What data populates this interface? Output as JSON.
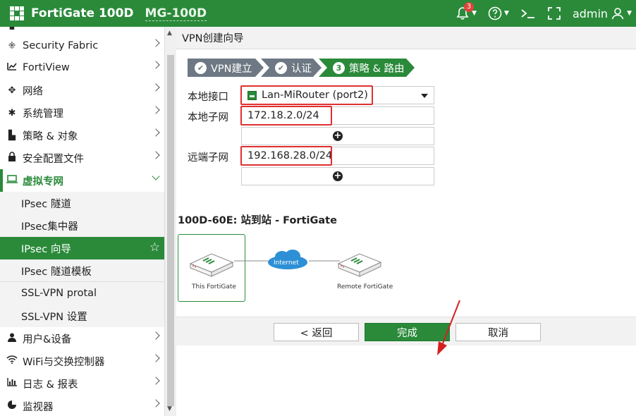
{
  "topbar": {
    "brand": "FortiGate 100D",
    "device": "MG-100D",
    "alert_count": "3",
    "help_icon": "question-circle-icon",
    "cli_icon": "terminal-icon",
    "fullscreen_icon": "fullscreen-icon",
    "user": "admin",
    "accent_color": "#2a8a3a"
  },
  "sidebar": {
    "items": [
      {
        "label": "Security Fabric",
        "icon": "fabric-icon"
      },
      {
        "label": "FortiView",
        "icon": "chart-icon"
      },
      {
        "label": "网络",
        "icon": "network-icon"
      },
      {
        "label": "系统管理",
        "icon": "gear-icon"
      },
      {
        "label": "策略 & 对象",
        "icon": "policy-icon"
      },
      {
        "label": "安全配置文件",
        "icon": "lock-icon"
      },
      {
        "label": "虚拟专网",
        "icon": "monitor-icon"
      },
      {
        "label": "用户&设备",
        "icon": "user-icon"
      },
      {
        "label": "WiFi与交换控制器",
        "icon": "wifi-icon"
      },
      {
        "label": "日志 & 报表",
        "icon": "log-chart-icon"
      },
      {
        "label": "监视器",
        "icon": "pie-icon"
      }
    ],
    "vpn_sub": [
      {
        "label": "IPsec 隧道"
      },
      {
        "label": "IPsec集中器"
      },
      {
        "label": "IPsec 向导"
      },
      {
        "label": "IPsec 隧道模板"
      },
      {
        "label": "SSL-VPN protal"
      },
      {
        "label": "SSL-VPN 设置"
      }
    ]
  },
  "main": {
    "header": "VPN创建向导",
    "steps": [
      "VPN建立",
      "认证",
      "策略 & 路由"
    ],
    "step3_number": "3",
    "local_interface_label": "本地接口",
    "local_interface_value": "Lan-MiRouter (port2)",
    "local_subnet_label": "本地子网",
    "local_subnet_value": "172.18.2.0/24",
    "remote_subnet_label": "远端子网",
    "remote_subnet_value": "192.168.28.0/24",
    "topology_title": "100D-60E: 站到站 - FortiGate",
    "topology": {
      "left_label": "This FortiGate",
      "cloud_label": "Internet",
      "right_label": "Remote FortiGate"
    },
    "buttons": {
      "back": "< 返回",
      "finish": "完成",
      "cancel": "取消"
    }
  }
}
